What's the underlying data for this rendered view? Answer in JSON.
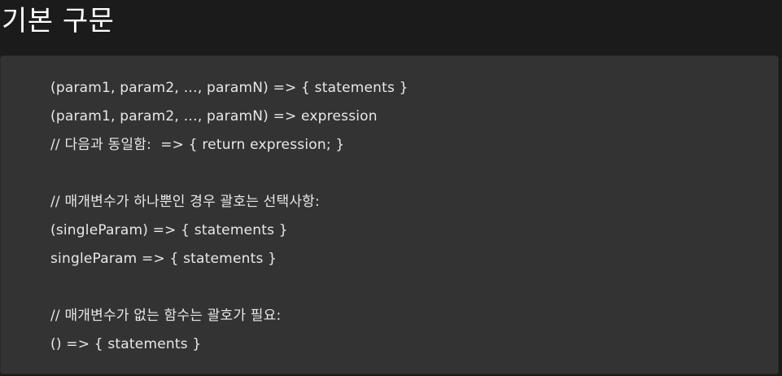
{
  "page": {
    "title": "기본 구문"
  },
  "code": {
    "lines": [
      "(param1, param2, …, paramN) => { statements }",
      "(param1, param2, …, paramN) => expression",
      "// 다음과 동일함:  => { return expression; }",
      "",
      "// 매개변수가 하나뿐인 경우 괄호는 선택사항:",
      "(singleParam) => { statements }",
      "singleParam => { statements }",
      "",
      "// 매개변수가 없는 함수는 괄호가 필요:",
      "() => { statements }"
    ]
  },
  "colors": {
    "background": "#1b1b1b",
    "code_background": "#333333",
    "text": "#e8e8e8"
  }
}
